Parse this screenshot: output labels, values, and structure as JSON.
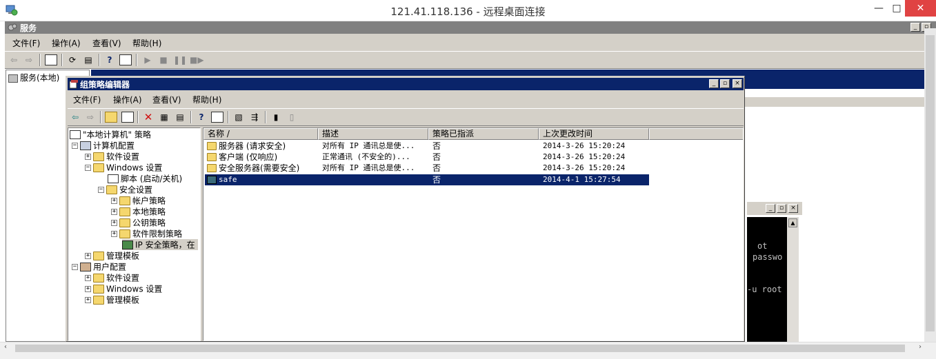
{
  "rdp": {
    "title": "121.41.118.136 - 远程桌面连接",
    "minimize": "—",
    "maximize": "□",
    "close": "✕"
  },
  "services": {
    "title": "服务",
    "menu": [
      "文件(F)",
      "操作(A)",
      "查看(V)",
      "帮助(H)"
    ],
    "tree_root": "服务(本地)"
  },
  "console": {
    "lines": [
      "ot",
      "passwo",
      "-u root"
    ]
  },
  "gpe": {
    "title": "组策略编辑器",
    "menu": [
      "文件(F)",
      "操作(A)",
      "查看(V)",
      "帮助(H)"
    ],
    "tree": [
      "\"本地计算机\" 策略",
      "计算机配置",
      "软件设置",
      "Windows 设置",
      "脚本 (启动/关机)",
      "安全设置",
      "帐户策略",
      "本地策略",
      "公钥策略",
      "软件限制策略",
      "IP 安全策略，在",
      "管理模板",
      "用户配置",
      "软件设置",
      "Windows 设置",
      "管理模板"
    ],
    "columns": [
      "名称 /",
      "描述",
      "策略已指派",
      "上次更改时间"
    ],
    "rows": [
      {
        "name": "服务器 (请求安全)",
        "desc": "对所有 IP 通讯总是使...",
        "assigned": "否",
        "modified": "2014-3-26 15:20:24"
      },
      {
        "name": "客户端 (仅响应)",
        "desc": "正常通讯 (不安全的)...",
        "assigned": "否",
        "modified": "2014-3-26 15:20:24"
      },
      {
        "name": "安全服务器(需要安全)",
        "desc": "对所有 IP 通讯总是使...",
        "assigned": "否",
        "modified": "2014-3-26 15:20:24"
      },
      {
        "name": "safe",
        "desc": "",
        "assigned": "否",
        "modified": "2014-4-1 15:27:54"
      }
    ]
  }
}
